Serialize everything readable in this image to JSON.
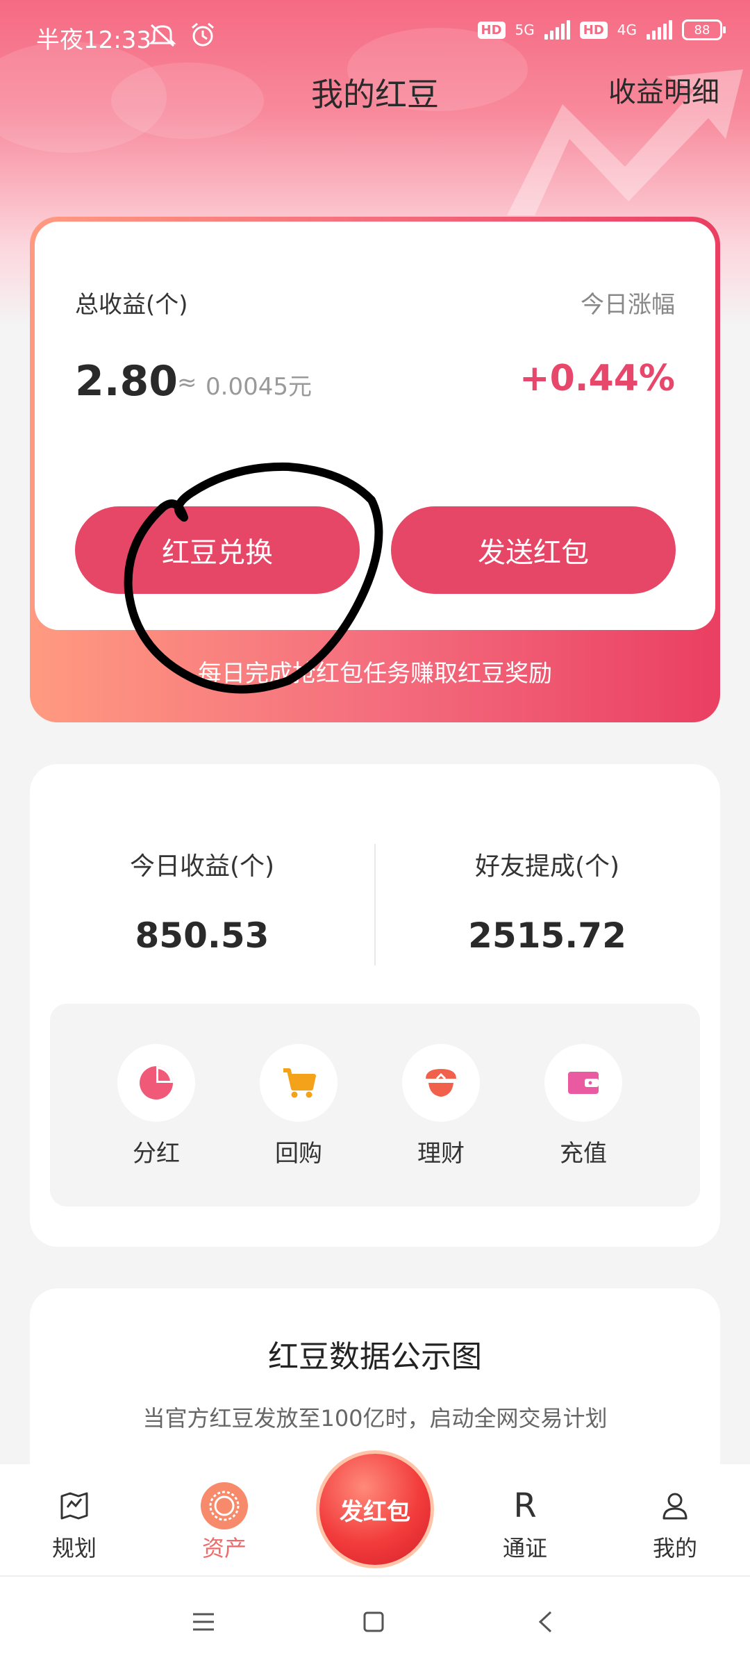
{
  "status_bar": {
    "time": "半夜12:33",
    "signal_1_label": "5G",
    "signal_2_label": "4G",
    "hd_label": "HD",
    "battery": "88"
  },
  "header": {
    "title": "我的红豆",
    "detail_link": "收益明细"
  },
  "earnings_card": {
    "total_label": "总收益(个)",
    "today_change_label": "今日涨幅",
    "total_value": "2.80",
    "approx_symbol": "≈",
    "yuan_value": "0.0045元",
    "today_change_value": "+0.44%",
    "exchange_button": "红豆兑换",
    "send_button": "发送红包",
    "task_text": "每日完成抢红包任务赚取红豆奖励"
  },
  "stats": {
    "today_label": "今日收益(个)",
    "today_value": "850.53",
    "friends_label": "好友提成(个)",
    "friends_value": "2515.72"
  },
  "actions": [
    {
      "label": "分红",
      "icon": "pie-chart-icon"
    },
    {
      "label": "回购",
      "icon": "shopping-cart-icon"
    },
    {
      "label": "理财",
      "icon": "finance-icon"
    },
    {
      "label": "充值",
      "icon": "wallet-icon"
    }
  ],
  "data_card": {
    "title": "红豆数据公示图",
    "subtitle": "当官方红豆发放至100亿时，启动全网交易计划"
  },
  "tab_bar": {
    "tabs": [
      {
        "label": "规划",
        "icon": "map-icon"
      },
      {
        "label": "资产",
        "icon": "asset-icon",
        "active": true
      },
      {
        "label": "通证",
        "icon": "token-r-icon"
      },
      {
        "label": "我的",
        "icon": "profile-icon"
      }
    ],
    "fab_label": "发红包"
  },
  "colors": {
    "accent": "#e64766",
    "positive": "#e6476a",
    "active_tab": "#f06a6a"
  }
}
